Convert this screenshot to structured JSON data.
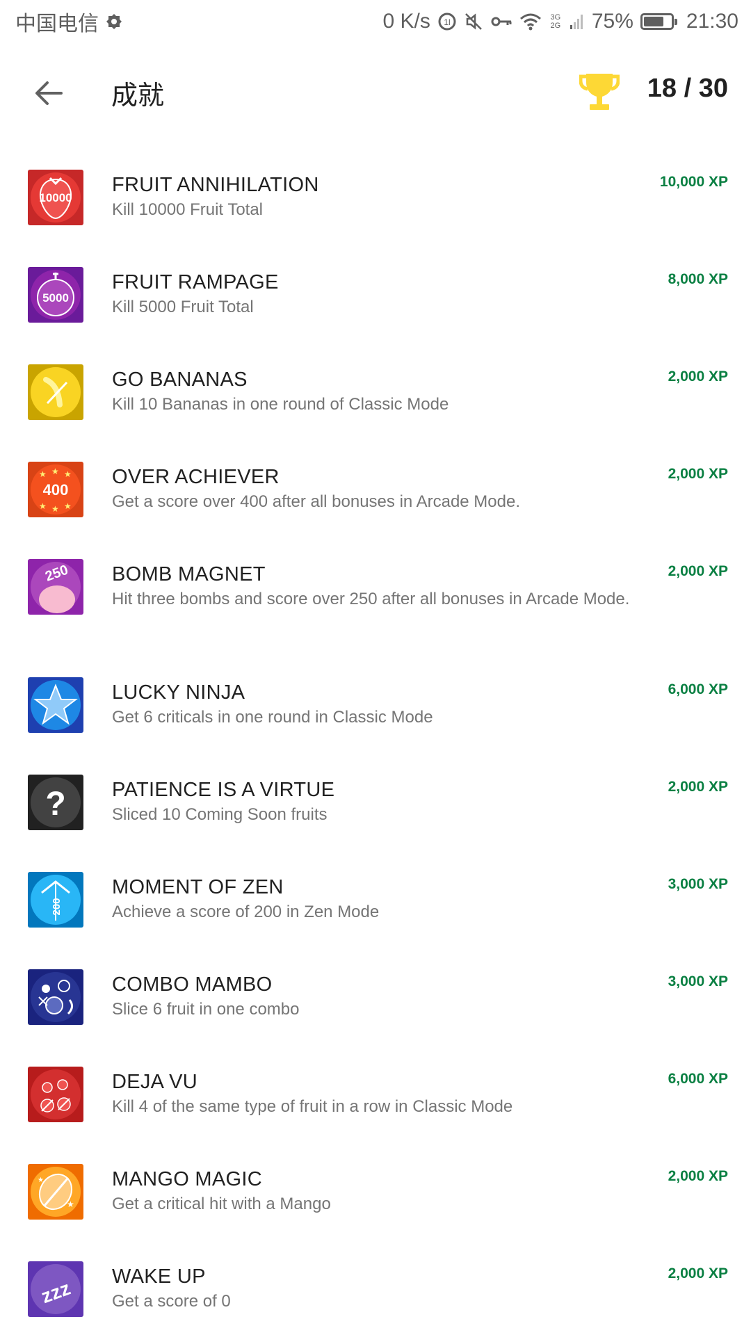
{
  "status_bar": {
    "carrier": "中国电信",
    "net_speed": "0 K/s",
    "network_type": "3G 2G",
    "battery_percent": "75%",
    "battery_level": 0.75,
    "time": "21:30"
  },
  "header": {
    "title": "成就",
    "score": "18 / 30",
    "trophy_color": "#fdd835"
  },
  "colors": {
    "xp_green": "#0b8043",
    "title_text": "#212121",
    "desc_text": "#757575"
  },
  "achievements": [
    {
      "title": "FRUIT ANNIHILATION",
      "desc": "Kill 10000 Fruit Total",
      "xp": "10,000 XP",
      "badge_text": "10000"
    },
    {
      "title": "FRUIT RAMPAGE",
      "desc": "Kill 5000 Fruit Total",
      "xp": "8,000 XP",
      "badge_text": "5000"
    },
    {
      "title": "GO BANANAS",
      "desc": "Kill 10 Bananas in one round of Classic Mode",
      "xp": "2,000 XP",
      "badge_text": ""
    },
    {
      "title": "OVER ACHIEVER",
      "desc": "Get a score over 400 after all bonuses in Arcade Mode.",
      "xp": "2,000 XP",
      "badge_text": "400"
    },
    {
      "title": "BOMB MAGNET",
      "desc": "Hit three bombs and score over 250 after all bonuses in Arcade Mode.",
      "xp": "2,000 XP",
      "badge_text": "250"
    },
    {
      "title": "LUCKY NINJA",
      "desc": "Get 6 criticals in one round in Classic Mode",
      "xp": "6,000 XP",
      "badge_text": ""
    },
    {
      "title": "PATIENCE IS A VIRTUE",
      "desc": "Sliced 10 Coming Soon fruits",
      "xp": "2,000 XP",
      "badge_text": "?"
    },
    {
      "title": "MOMENT OF ZEN",
      "desc": "Achieve a score of 200 in Zen Mode",
      "xp": "3,000 XP",
      "badge_text": "200"
    },
    {
      "title": "COMBO MAMBO",
      "desc": "Slice 6 fruit in one combo",
      "xp": "3,000 XP",
      "badge_text": ""
    },
    {
      "title": "DEJA VU",
      "desc": "Kill 4 of the same type of fruit in a row in Classic Mode",
      "xp": "6,000 XP",
      "badge_text": ""
    },
    {
      "title": "MANGO MAGIC",
      "desc": "Get a critical hit with a Mango",
      "xp": "2,000 XP",
      "badge_text": ""
    },
    {
      "title": "WAKE UP",
      "desc": "Get a score of 0",
      "xp": "2,000 XP",
      "badge_text": "zzz"
    }
  ]
}
